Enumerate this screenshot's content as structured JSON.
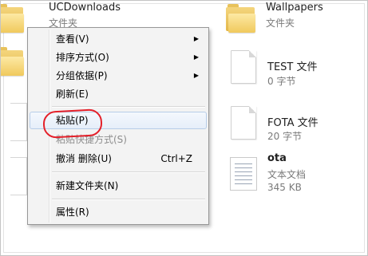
{
  "files": [
    {
      "name": "UCDownloads",
      "type": "文件夹",
      "size": ""
    },
    {
      "name": "Wallpapers",
      "type": "文件夹",
      "size": ""
    },
    {
      "name": "TEST 文件",
      "type": "",
      "size": "0 字节"
    },
    {
      "name": "FOTA 文件",
      "type": "",
      "size": "20 字节"
    },
    {
      "name": "ota",
      "type": "文本文档",
      "size": "345 KB"
    }
  ],
  "context_menu": {
    "items": [
      {
        "label": "查看(V)",
        "submenu": true
      },
      {
        "label": "排序方式(O)",
        "submenu": true
      },
      {
        "label": "分组依据(P)",
        "submenu": true
      },
      {
        "label": "刷新(E)"
      },
      {
        "label": "粘贴(P)"
      },
      {
        "label": "粘贴快捷方式(S)",
        "disabled": true
      },
      {
        "label": "撤消 删除(U)",
        "shortcut": "Ctrl+Z"
      },
      {
        "label": "新建文件夹(N)"
      },
      {
        "label": "属性(R)"
      }
    ],
    "submenu_arrow": "▶"
  },
  "colors": {
    "annotation": "#e4202a",
    "hover_bg": "#e6eef9"
  }
}
